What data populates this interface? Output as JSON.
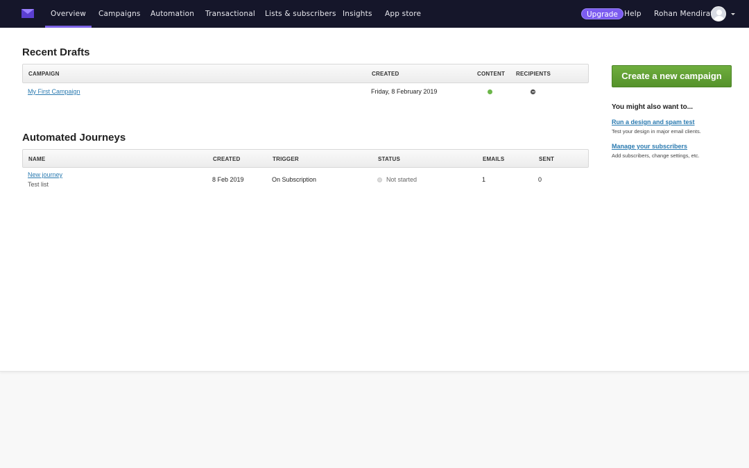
{
  "nav": {
    "items": [
      {
        "label": "Overview",
        "active": true
      },
      {
        "label": "Campaigns"
      },
      {
        "label": "Automation"
      },
      {
        "label": "Transactional"
      },
      {
        "label": "Lists & subscribers"
      },
      {
        "label": "Insights"
      },
      {
        "label": "App store"
      }
    ],
    "upgrade_label": "Upgrade",
    "help_label": "Help",
    "user_name": "Rohan Mendirata",
    "accent_color": "#7c5cf0"
  },
  "drafts": {
    "title": "Recent Drafts",
    "columns": [
      "CAMPAIGN",
      "CREATED",
      "CONTENT",
      "RECIPIENTS"
    ],
    "rows": [
      {
        "campaign": "My First Campaign",
        "created": "Friday, 8 February 2019",
        "content": "complete",
        "recipients": "incomplete"
      }
    ]
  },
  "journeys": {
    "title": "Automated Journeys",
    "columns": [
      "NAME",
      "CREATED",
      "TRIGGER",
      "STATUS",
      "EMAILS",
      "SENT"
    ],
    "rows": [
      {
        "name": "New journey",
        "list": "Test list",
        "created": "8 Feb 2019",
        "trigger": "On Subscription",
        "status": "Not started",
        "emails": "1",
        "sent": "0"
      }
    ]
  },
  "sidebar": {
    "create_button": "Create a new campaign",
    "suggest_title": "You might also want to...",
    "suggestions": [
      {
        "link": "Run a design and spam test",
        "desc": "Test your design in major email clients."
      },
      {
        "link": "Manage your subscribers",
        "desc": "Add subscribers, change settings, etc."
      }
    ]
  }
}
